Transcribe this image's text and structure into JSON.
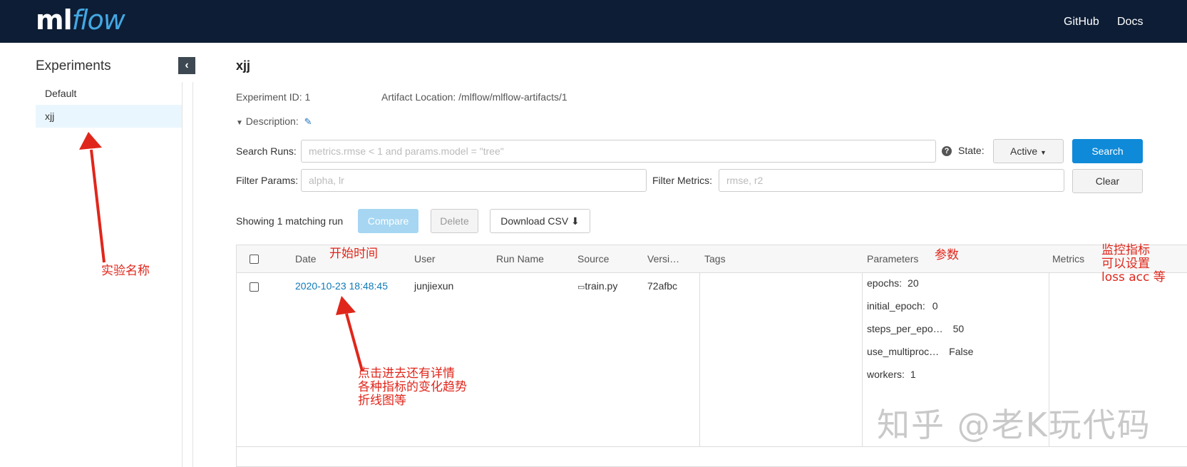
{
  "header": {
    "logo_ml": "ml",
    "logo_flow": "flow",
    "nav": [
      "GitHub",
      "Docs"
    ]
  },
  "sidebar": {
    "title": "Experiments",
    "collapse_icon": "chevron-left-icon",
    "items": [
      "Default",
      "xjj"
    ],
    "active_item": "xjj"
  },
  "experiment": {
    "name": "xjj",
    "id_text": "Experiment ID: 1",
    "artifact_text": "Artifact Location: /mlflow/mlflow-artifacts/1",
    "description_label": "Description:"
  },
  "search": {
    "runs_label": "Search Runs:",
    "runs_placeholder": "metrics.rmse < 1 and params.model = \"tree\"",
    "state_label": "State:",
    "state_value": "Active",
    "search_button": "Search",
    "params_label": "Filter Params:",
    "params_placeholder": "alpha, lr",
    "metrics_label": "Filter Metrics:",
    "metrics_placeholder": "rmse, r2",
    "clear_button": "Clear"
  },
  "actions": {
    "showing": "Showing 1 matching run",
    "compare": "Compare",
    "delete": "Delete",
    "download": "Download CSV"
  },
  "table": {
    "headers": {
      "date": "Date",
      "user": "User",
      "run_name": "Run Name",
      "source": "Source",
      "version": "Versi…",
      "tags": "Tags",
      "parameters": "Parameters",
      "metrics": "Metrics"
    },
    "rows": [
      {
        "date": "2020-10-23 18:48:45",
        "user": "junjiexun",
        "run_name": "",
        "source": "train.py",
        "version": "72afbc",
        "params": [
          {
            "key": "epochs:",
            "value": "20"
          },
          {
            "key": "initial_epoch:",
            "value": "0"
          },
          {
            "key": "steps_per_epo…",
            "value": "50"
          },
          {
            "key": "use_multiproc…",
            "value": "False"
          },
          {
            "key": "workers:",
            "value": "1"
          }
        ]
      }
    ]
  },
  "annotations": {
    "experiment_name": "实验名称",
    "start_time": "开始时间",
    "click_details": [
      "点击进去还有详情",
      "各种指标的变化趋势",
      "折线图等"
    ],
    "parameters": "参数",
    "metrics_note": [
      "监控指标",
      "可以设置",
      "loss acc 等"
    ],
    "arrow_color": "#e0261b"
  },
  "watermark": "知乎 @老K玩代码",
  "colors": {
    "topbar": "#0d1d35",
    "primary": "#0f8ad8",
    "link": "#0f7ab8",
    "annotation": "#e0261b"
  }
}
